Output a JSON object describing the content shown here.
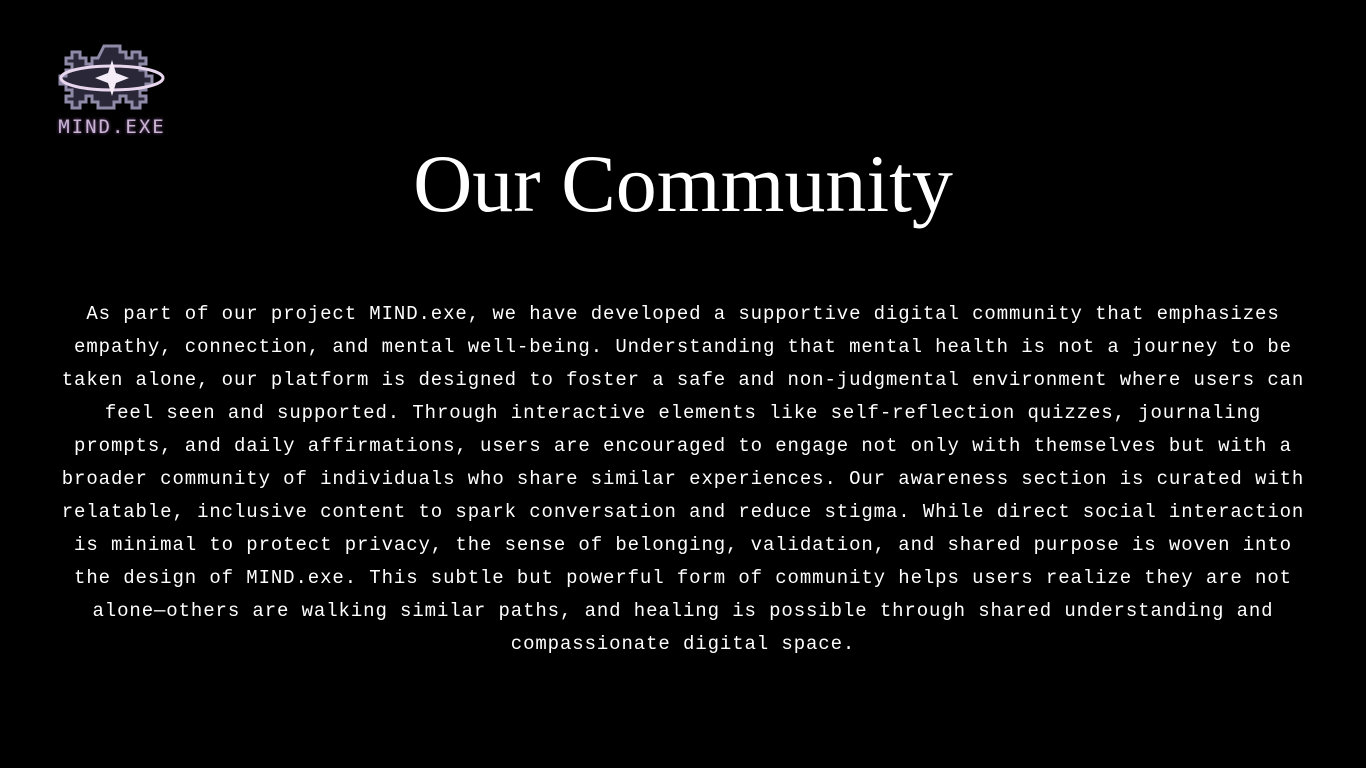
{
  "logo": {
    "text": "MIND.EXE",
    "icon": "pixel-star-orbit-icon"
  },
  "title": "Our Community",
  "body": "As part of our project MIND.exe, we have developed a supportive digital community that emphasizes empathy, connection, and mental well-being. Understanding that mental health is not a journey to be taken alone, our platform is designed to foster a safe and non-judgmental environment where users can feel seen and supported. Through interactive elements like self-reflection quizzes, journaling prompts, and daily affirmations, users are encouraged to engage not only with themselves but with a broader community of individuals who share similar experiences. Our awareness section is curated with relatable, inclusive content to spark conversation and reduce stigma. While direct social interaction is minimal to protect privacy, the sense of belonging, validation, and shared purpose is woven into the design of MIND.exe. This subtle but powerful form of community helps users realize they are not alone—others are walking similar paths, and healing is possible through shared understanding and compassionate digital space.",
  "colors": {
    "background": "#000000",
    "text": "#ffffff",
    "logo_accent": "#c9b4d2",
    "logo_block": "#8e8aa8"
  }
}
